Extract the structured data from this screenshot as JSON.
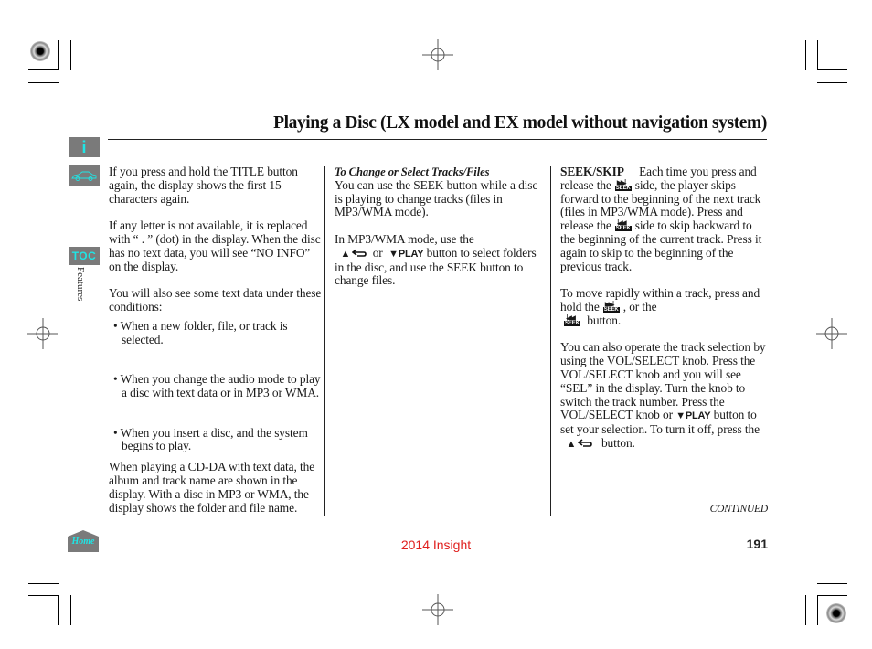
{
  "page": {
    "title": "Playing a Disc (LX model and EX model without navigation system)",
    "section_label": "Features",
    "page_number": "191",
    "footer_model": "2014 Insight",
    "continued": "CONTINUED"
  },
  "nav": {
    "info_icon_label": "i",
    "toc_label": "TOC",
    "home_label": "Home"
  },
  "colors": {
    "nav_icon_bg": "#7a7a7a",
    "nav_icon_fg": "#1fe5e5",
    "footer_model": "#e0201e"
  },
  "column1": {
    "p1": "If you press and hold the TITLE button again, the display shows the first 15 characters again.",
    "p2": "If any letter is not available, it is replaced with “ . ” (dot) in the display. When the disc has no text data, you will see “NO INFO” on the display.",
    "p3": "You will also see some text data under these conditions:",
    "bullets": [
      "When a new folder, file, or track is selected.",
      "When you change the audio mode to play a disc with text data or in MP3 or WMA.",
      "When you insert a disc, and the system begins to play."
    ],
    "p4": "When playing a CD-DA with text data, the album and track name are shown in the display. With a disc in MP3 or WMA, the display shows the folder and file name."
  },
  "column2": {
    "subheading": "To Change or Select Tracks/Files",
    "p1": "You can use the SEEK button while a disc is playing to change tracks (files in MP3/WMA mode).",
    "p2_a": "In MP3/WMA mode, use the",
    "p2_or": "or",
    "p2_b": "button to select folders in the disc, and use the SEEK button to change files."
  },
  "column3": {
    "heading": "SEEK/SKIP",
    "p1_a": "Each time you press and release the",
    "p1_b": "side, the player skips forward to the beginning of the next track (files in MP3/WMA mode). Press and release the",
    "p1_c": "side to skip backward to the beginning of the current track. Press it again to skip to the beginning of the previous track.",
    "p2_a": "To move rapidly within a track, press and hold the",
    "p2_b": ", or the",
    "p2_c": "button.",
    "p3_a": "You can also operate the track selection by using the VOL/SELECT knob. Press the VOL/SELECT knob and you will see “SEL” in the display. Turn the knob to switch the track number. Press the VOL/SELECT knob or",
    "p3_b": "button to set your selection. To turn it off, press the",
    "p3_c": "button."
  },
  "buttons": {
    "play": "▼PLAY",
    "up_arrow": "▲",
    "seek_label": "SEEK",
    "seek_forward_glyph": "▶▶|",
    "seek_back_glyph": "|◀◀"
  }
}
